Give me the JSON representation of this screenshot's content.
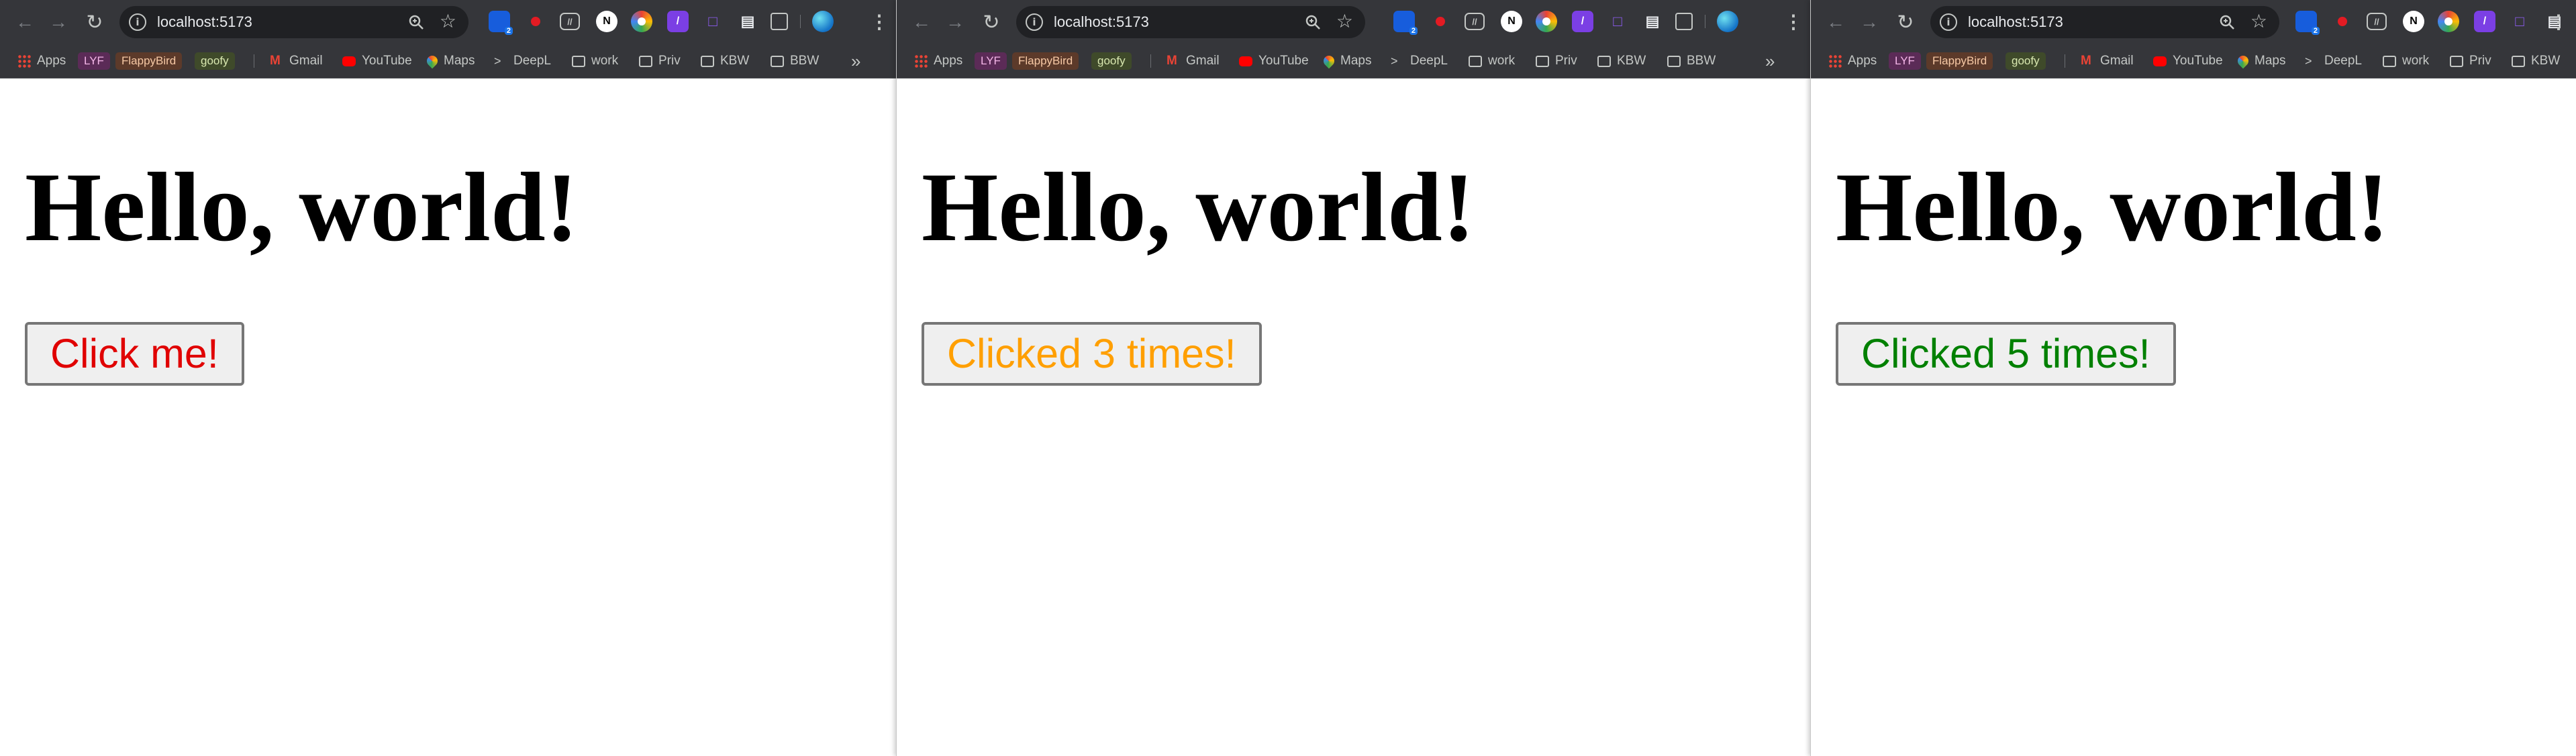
{
  "browser": {
    "url": "localhost:5173",
    "bookmarks": {
      "apps": "Apps",
      "lyf": "LYF",
      "flappy": "FlappyBird",
      "goofy": "goofy",
      "gmail": "Gmail",
      "youtube": "YouTube",
      "maps": "Maps",
      "deepl": "DeepL",
      "work": "work",
      "priv": "Priv",
      "kbw": "KBW",
      "bbw": "BBW",
      "more": "»"
    },
    "extensions": [
      "bitwarden-icon",
      "record-icon",
      "reader-icon",
      "notion-icon",
      "color-picker-icon",
      "vpn-icon",
      "screenshot-icon",
      "document-icon",
      "extensions-puzzle-icon",
      "edge-icon"
    ],
    "badge": "2"
  },
  "page": {
    "heading": "Hello, world!"
  },
  "windows": [
    {
      "button_label": "Click me!",
      "button_color": "#e00000",
      "clicks": 0
    },
    {
      "button_label": "Clicked 3 times!",
      "button_color": "#ff9f00",
      "clicks": 3
    },
    {
      "button_label": "Clicked 5 times!",
      "button_color": "#008000",
      "clicks": 5
    }
  ],
  "colors": {
    "toolbar": "#35363a",
    "omnibox": "#202124",
    "page_bg": "#ffffff"
  }
}
